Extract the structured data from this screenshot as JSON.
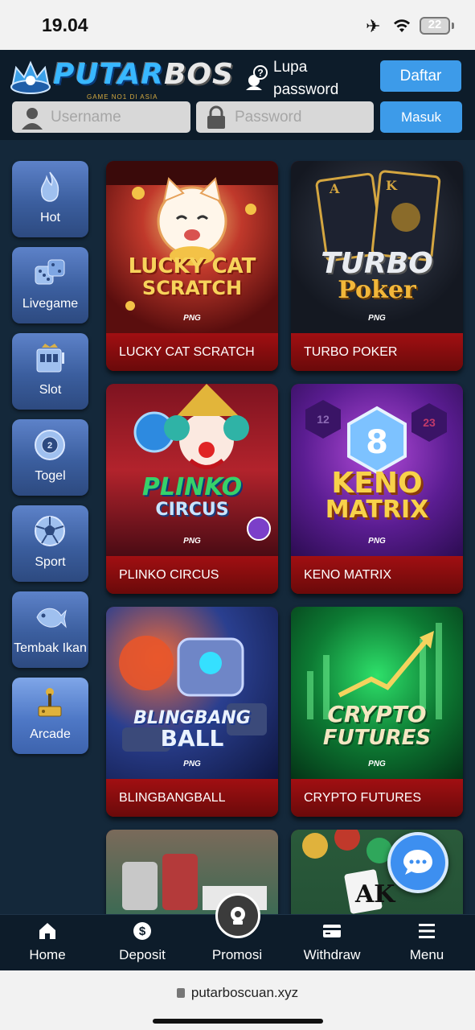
{
  "status_bar": {
    "time": "19.04",
    "battery": "22"
  },
  "header": {
    "logo_text_1": "PUTAR",
    "logo_text_2": "BOS",
    "logo_tagline": "GAME  NO1 DI ASIA",
    "forgot_password": "Lupa password",
    "register_button": "Daftar",
    "username_placeholder": "Username",
    "password_placeholder": "Password",
    "login_button": "Masuk"
  },
  "sidebar": {
    "items": [
      {
        "label": "Hot",
        "icon": "flame-icon"
      },
      {
        "label": "Livegame",
        "icon": "dice-icon"
      },
      {
        "label": "Slot",
        "icon": "slot-machine-icon"
      },
      {
        "label": "Togel",
        "icon": "lottery-ball-icon"
      },
      {
        "label": "Sport",
        "icon": "soccer-ball-icon"
      },
      {
        "label": "Tembak Ikan",
        "icon": "fish-icon"
      },
      {
        "label": "Arcade",
        "icon": "joystick-icon"
      }
    ]
  },
  "games": [
    {
      "title": "LUCKY CAT SCRATCH",
      "art_line1": "LUCKY CAT",
      "art_line2": "SCRATCH",
      "provider": "PNG"
    },
    {
      "title": "TURBO POKER",
      "art_line1": "TURBO",
      "art_line2": "Poker",
      "provider": "PNG"
    },
    {
      "title": "PLINKO CIRCUS",
      "art_line1": "PLINKO",
      "art_line2": "CIRCUS",
      "provider": "PNG"
    },
    {
      "title": "KENO MATRIX",
      "art_line1": "KENO",
      "art_line2": "MATRIX",
      "provider": "PNG",
      "badge": "8",
      "ball_1": "12",
      "ball_2": "23"
    },
    {
      "title": "BLINGBANGBALL",
      "art_line1": "BLINGBANG",
      "art_line2": "BALL",
      "provider": "PNG"
    },
    {
      "title": "CRYPTO FUTURES",
      "art_line1": "CRYPTO",
      "art_line2": "FUTURES",
      "provider": "PNG"
    }
  ],
  "bottom_nav": [
    {
      "label": "Home",
      "icon": "home-icon"
    },
    {
      "label": "Deposit",
      "icon": "dollar-icon"
    },
    {
      "label": "Promosi",
      "icon": "promo-icon"
    },
    {
      "label": "Withdraw",
      "icon": "card-icon"
    },
    {
      "label": "Menu",
      "icon": "hamburger-icon"
    }
  ],
  "url_bar": {
    "url": "putarboscuan.xyz"
  }
}
